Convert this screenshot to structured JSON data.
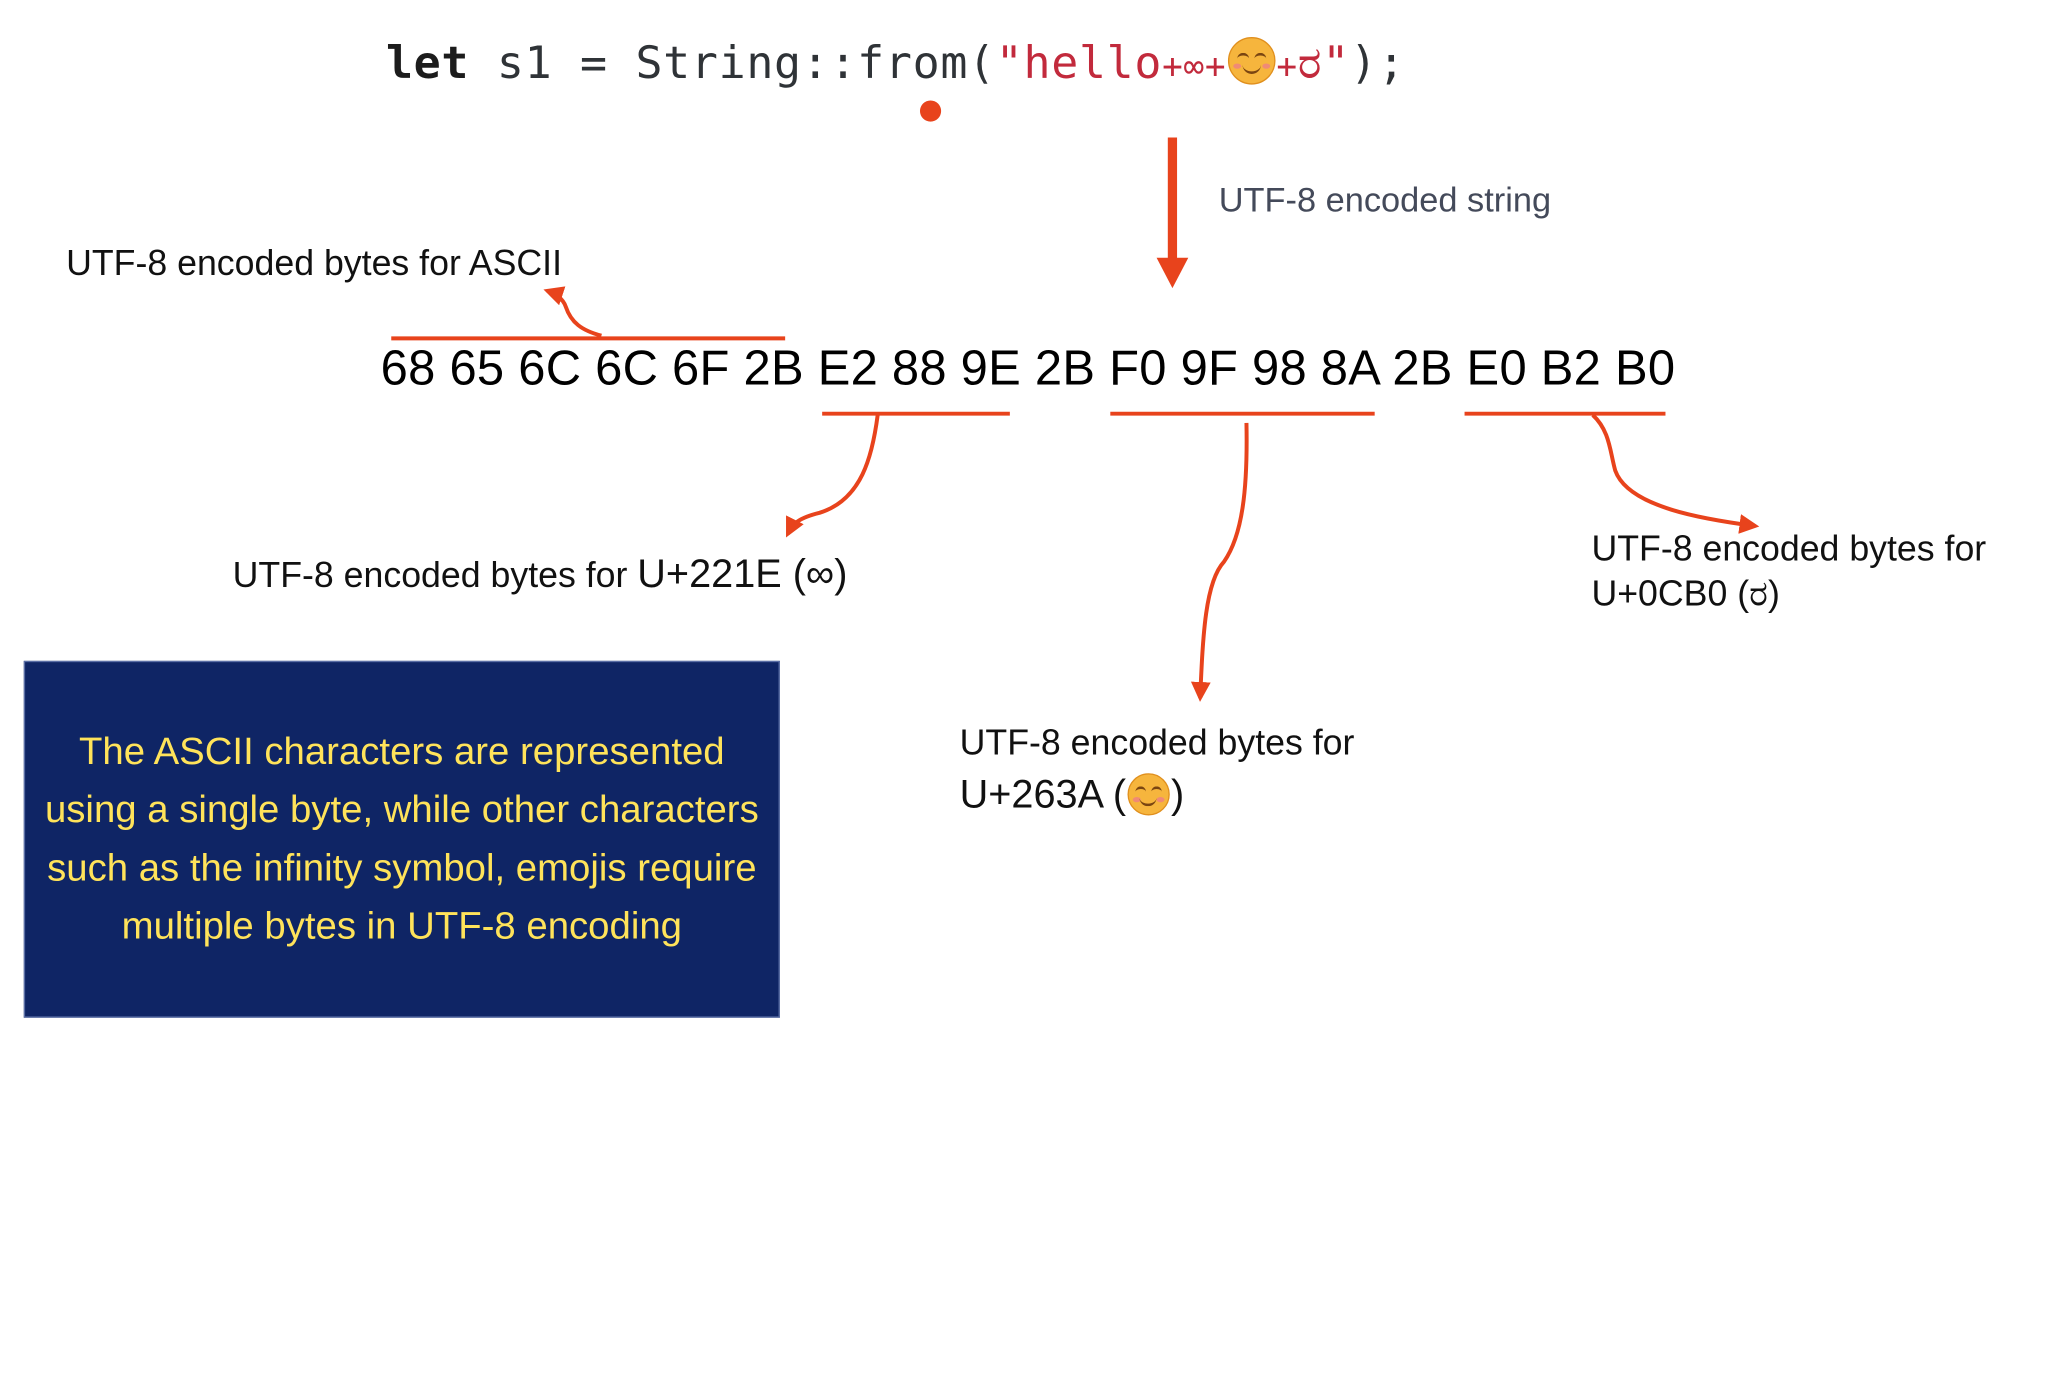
{
  "code": {
    "keyword": "let",
    "ident": " s1 = String::from(",
    "quote_open": "\"",
    "text_hello": "hello",
    "plus1": "+",
    "infinity": "∞",
    "plus2": "+",
    "plus3": "+",
    "kannada": "ರ",
    "quote_close": "\"",
    "tail": ");"
  },
  "arrow_label": "UTF-8 encoded string",
  "bytes": {
    "ascii": "68 65 6C 6C 6F 2B",
    "infinity": "E2 88 9E",
    "sep1": "2B",
    "emoji": "F0 9F 98 8A",
    "sep2": "2B",
    "kannada": "E0 B2 B0"
  },
  "annotations": {
    "ascii": "UTF-8 encoded bytes for ASCII",
    "infinity_prefix": "UTF-8 encoded bytes for ",
    "infinity_code": "U+221E (∞)",
    "emoji_line1": "UTF-8 encoded bytes for",
    "emoji_code_open": "U+263A (",
    "emoji_code_close": ")",
    "kannada_line1": "UTF-8 encoded bytes for",
    "kannada_line2": "U+0CB0 (ರ)"
  },
  "note": "The ASCII characters are represented using a single byte, while other characters such as the infinity symbol, emojis require multiple bytes in UTF-8 encoding",
  "colors": {
    "accent": "#e8431c",
    "box_bg": "#0f2565",
    "box_text": "#ffe35a",
    "string": "#c22a3c"
  },
  "icons": [
    "smiling-face-emoji-icon",
    "red-cursor-dot-icon"
  ]
}
